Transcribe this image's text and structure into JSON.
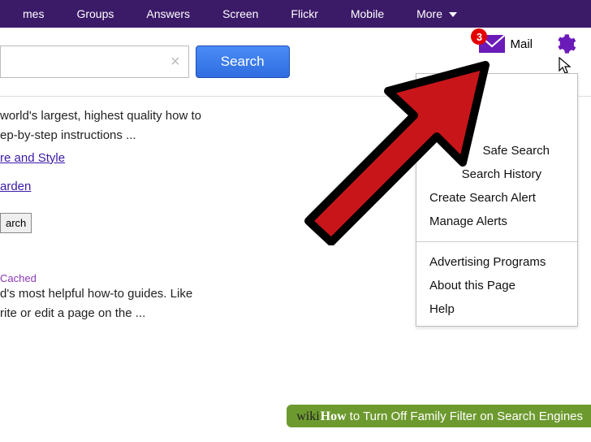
{
  "nav": {
    "items": [
      "mes",
      "Groups",
      "Answers",
      "Screen",
      "Flickr",
      "Mobile"
    ],
    "more_label": "More"
  },
  "search": {
    "value": "",
    "button_label": "Search"
  },
  "mail": {
    "badge": "3",
    "label": "Mail"
  },
  "dropdown": {
    "group1": [
      "Safe Search",
      "Search History",
      "Create Search Alert",
      "Manage Alerts"
    ],
    "group2": [
      "Advertising Programs",
      "About this Page",
      "Help"
    ]
  },
  "results": {
    "snippet1_a": "world's largest, highest quality how to",
    "snippet1_b": "ep-by-step instructions ...",
    "link1": "re and Style",
    "link2": "arden",
    "arch_btn": "arch",
    "cached": "Cached",
    "snippet2_a": "d's most helpful how-to guides. Like",
    "snippet2_b": "rite or edit a page on the ..."
  },
  "caption": {
    "brand_a": "wiki",
    "brand_b": "How",
    "text": " to Turn Off Family Filter on Search Engines"
  }
}
